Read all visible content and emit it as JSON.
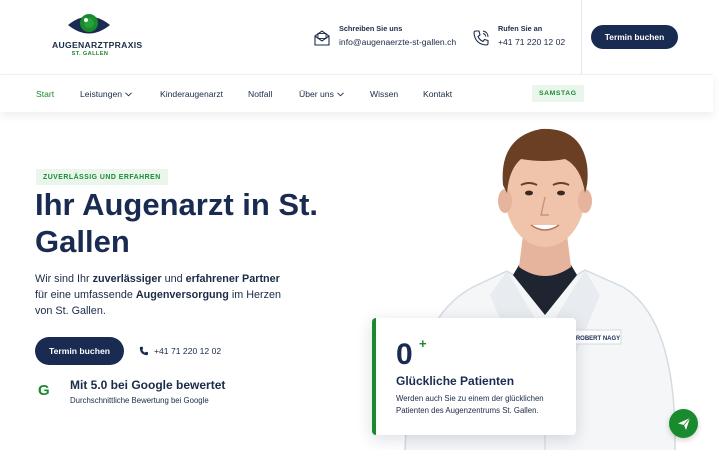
{
  "brand": {
    "name": "AUGENARZTPRAXIS",
    "city": "ST. GALLEN",
    "colors": {
      "navy": "#1a2b52",
      "green": "#1a8a2e",
      "light_green": "#eaf6ec"
    }
  },
  "header": {
    "mail": {
      "label": "Schreiben Sie uns",
      "value": "info@augenaerzte-st-gallen.ch",
      "icon": "envelope-icon"
    },
    "phone": {
      "label": "Rufen Sie an",
      "value": "+41 71 220 12 02",
      "icon": "phone-icon"
    },
    "cta": "Termin buchen"
  },
  "nav": {
    "items": [
      {
        "label": "Start",
        "active": true
      },
      {
        "label": "Leistungen",
        "dropdown": true
      },
      {
        "label": "Kinderaugenarzt"
      },
      {
        "label": "Notfall"
      },
      {
        "label": "Über uns",
        "dropdown": true
      },
      {
        "label": "Wissen"
      },
      {
        "label": "Kontakt"
      }
    ],
    "badge": "SAMSTAG"
  },
  "hero": {
    "eyebrow": "ZUVERLÄSSIG UND ERFAHREN",
    "title": "Ihr Augenarzt in St. Gallen",
    "text_parts": [
      "Wir sind Ihr ",
      "zuverlässiger",
      " und ",
      "erfahrener Partner",
      " für eine umfassende ",
      "Augenversorgung",
      " im Herzen von St. Gallen."
    ],
    "cta": "Termin buchen",
    "phone": "+41 71 220 12 02"
  },
  "google": {
    "letter": "G",
    "title": "Mit 5.0 bei Google bewertet",
    "subtitle": "Durchschnittliche Bewertung bei Google"
  },
  "doctor": {
    "badge_name": "ROBERT NAGY"
  },
  "stats": {
    "number": "0",
    "plus": "+",
    "title": "Glückliche Patienten",
    "text": "Werden auch Sie zu einem der glücklichen Patienten des Augenzentrums St. Gallen."
  },
  "fab": {
    "icon": "send-icon"
  }
}
